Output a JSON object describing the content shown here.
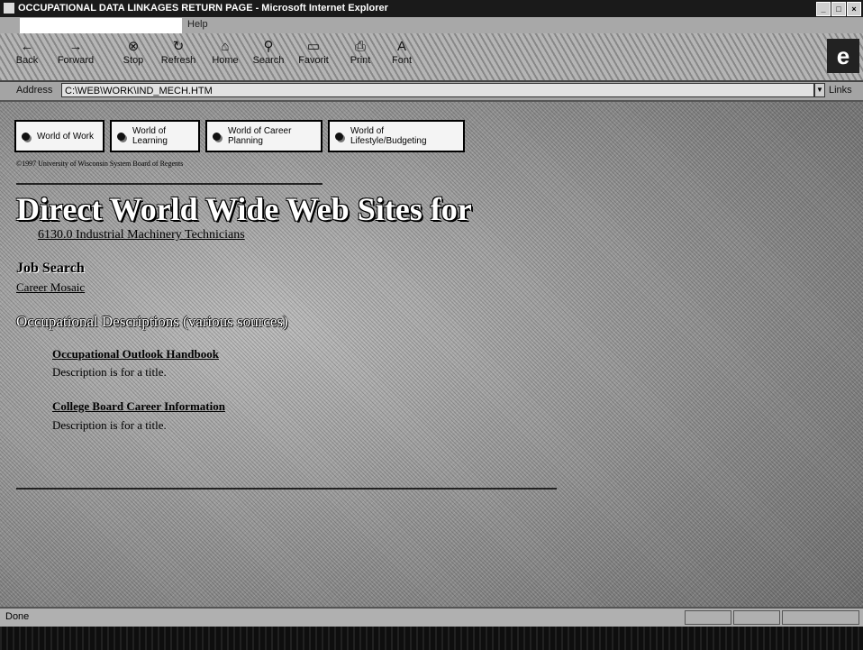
{
  "window": {
    "title": "OCCUPATIONAL DATA LINKAGES RETURN PAGE - Microsoft Internet Explorer",
    "controls": [
      "_",
      "□",
      "×"
    ]
  },
  "menubar": {
    "items": [
      "Help"
    ]
  },
  "toolbar": {
    "buttons": [
      {
        "label": "Back",
        "icon": "back-arrow-icon",
        "glyph": "←"
      },
      {
        "label": "Forward",
        "icon": "forward-arrow-icon",
        "glyph": "→"
      },
      {
        "label": "Stop",
        "icon": "stop-icon",
        "glyph": "⊗"
      },
      {
        "label": "Refresh",
        "icon": "refresh-icon",
        "glyph": "↻"
      },
      {
        "label": "Home",
        "icon": "home-icon",
        "glyph": "⌂"
      },
      {
        "label": "Search",
        "icon": "search-icon",
        "glyph": "⚲"
      },
      {
        "label": "Favorit",
        "icon": "favorites-icon",
        "glyph": "▭"
      },
      {
        "label": "Print",
        "icon": "print-icon",
        "glyph": "⎙"
      },
      {
        "label": "Font",
        "icon": "font-icon",
        "glyph": "A"
      }
    ],
    "logo_glyph": "e"
  },
  "address": {
    "label": "Address",
    "value": "C:\\WEB\\WORK\\IND_MECH.HTM",
    "links_label": "Links"
  },
  "nav": [
    {
      "label": "World of Work"
    },
    {
      "label": "World of Learning"
    },
    {
      "label": "World of Career Planning"
    },
    {
      "label": "World of Lifestyle/Budgeting"
    }
  ],
  "copyright": "©1997 University of Wisconsin System Board of Regents",
  "page": {
    "heading": "Direct World Wide Web Sites for",
    "subtitle_link": "6130.0 Industrial Machinery Technicians",
    "job_search": {
      "heading": "Job Search",
      "link": "Career Mosaic"
    },
    "occupational": {
      "heading": "Occupational Descriptions (various sources)",
      "entries": [
        {
          "link": "Occupational Outlook Handbook",
          "description": "Description is for a title."
        },
        {
          "link": "College Board Career Information",
          "description": "Description is for a title."
        }
      ]
    }
  },
  "status": {
    "text": "Done"
  }
}
